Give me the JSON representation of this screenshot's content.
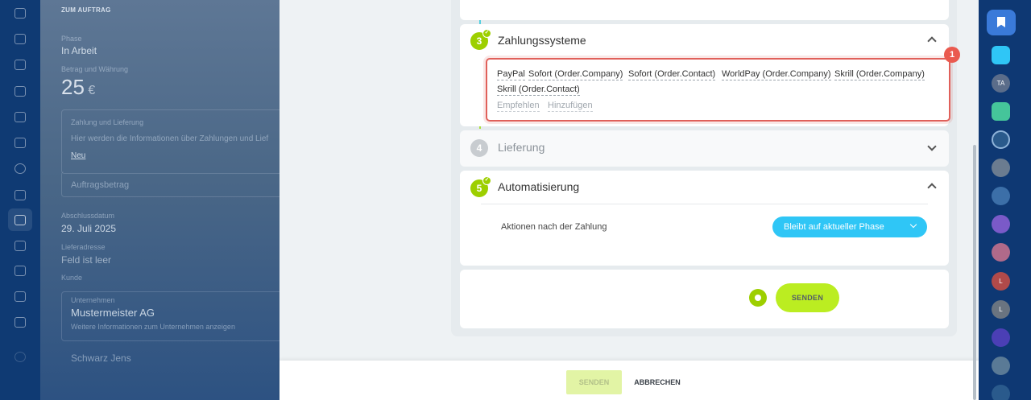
{
  "background_panel": {
    "heading": "ZUM AUFTRAG",
    "phase_label": "Phase",
    "phase_value": "In Arbeit",
    "amount_label": "Betrag und Währung",
    "amount_value": "25",
    "currency": "€",
    "payment_section_label": "Zahlung und Lieferung",
    "payment_section_hint": "Hier werden die Informationen über Zahlungen und Lief",
    "new_link": "Neu",
    "order_amount_label": "Auftragsbetrag",
    "close_date_label": "Abschlussdatum",
    "close_date_value": "29. Juli 2025",
    "field2_label": "Lieferadresse",
    "field2_value": "Feld ist leer",
    "field3_label": "Kunde",
    "company_label": "Unternehmen",
    "company_value": "Mustermeister AG",
    "company_sub": "Weitere Informationen zum Unternehmen anzeigen",
    "contact_value": "Schwarz Jens"
  },
  "steps": {
    "payment": {
      "number": "3",
      "title": "Zahlungssysteme",
      "systems": [
        "PayPal",
        "Sofort (Order.Company)",
        "Sofort (Order.Contact)",
        "WorldPay (Order.Company)",
        "Skrill (Order.Company)",
        "Skrill (Order.Contact)"
      ],
      "recommend_link": "Empfehlen",
      "add_link": "Hinzufügen"
    },
    "delivery": {
      "number": "4",
      "title": "Lieferung"
    },
    "automation": {
      "number": "5",
      "title": "Automatisierung",
      "action_label": "Aktionen nach der Zahlung",
      "action_value": "Bleibt auf aktueller Phase"
    },
    "send_label": "SENDEN"
  },
  "annotation_badge": "1",
  "footer": {
    "send_label": "SENDEN",
    "cancel_label": "ABBRECHEN"
  },
  "right_rail": {
    "avatar_initials": [
      "TA",
      "L",
      "L"
    ]
  },
  "colors": {
    "accent_green": "#9dcf00",
    "send_green": "#bbed21",
    "select_blue": "#2fc6f6",
    "highlight_red": "#e0605a",
    "rail_blue": "#0e3873"
  }
}
